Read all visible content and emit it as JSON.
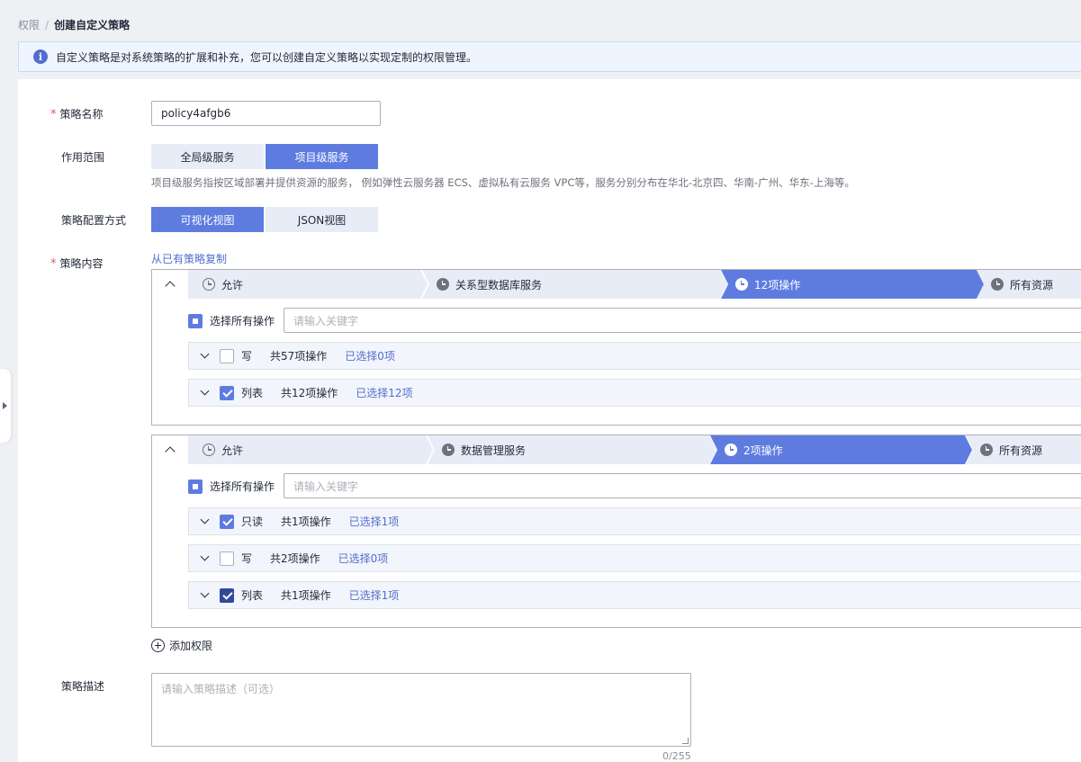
{
  "breadcrumb": {
    "parent": "权限",
    "separator": "/",
    "current": "创建自定义策略"
  },
  "info": {
    "icon": "info-icon",
    "text": "自定义策略是对系统策略的扩展和补充，您可以创建自定义策略以实现定制的权限管理。"
  },
  "form": {
    "policy_name": {
      "label": "策略名称",
      "required": true,
      "value": "policy4afgb6"
    },
    "scope": {
      "label": "作用范围",
      "options": [
        "全局级服务",
        "项目级服务"
      ],
      "selected": "项目级服务",
      "hint": "项目级服务指按区域部署并提供资源的服务， 例如弹性云服务器 ECS、虚拟私有云服务 VPC等，服务分别分布在华北-北京四、华南-广州、华东-上海等。"
    },
    "config_mode": {
      "label": "策略配置方式",
      "options": [
        "可视化视图",
        "JSON视图"
      ],
      "selected": "可视化视图"
    },
    "content": {
      "label": "策略内容",
      "required": true,
      "copy_link": "从已有策略复制",
      "blocks": [
        {
          "steps": [
            "允许",
            "关系型数据库服务",
            "12项操作",
            "所有资源"
          ],
          "active_step": 2,
          "select_all_label": "选择所有操作",
          "search_placeholder": "请输入关键字",
          "groups": [
            {
              "name": "写",
              "count": "共57项操作",
              "selected": "已选择0项",
              "checked": false
            },
            {
              "name": "列表",
              "count": "共12项操作",
              "selected": "已选择12项",
              "checked": true
            }
          ]
        },
        {
          "steps": [
            "允许",
            "数据管理服务",
            "2项操作",
            "所有资源"
          ],
          "active_step": 2,
          "select_all_label": "选择所有操作",
          "search_placeholder": "请输入关键字",
          "groups": [
            {
              "name": "只读",
              "count": "共1项操作",
              "selected": "已选择1项",
              "checked": true
            },
            {
              "name": "写",
              "count": "共2项操作",
              "selected": "已选择0项",
              "checked": false
            },
            {
              "name": "列表",
              "count": "共1项操作",
              "selected": "已选择1项",
              "checked": true
            }
          ]
        }
      ],
      "add_label": "添加权限"
    },
    "description": {
      "label": "策略描述",
      "placeholder": "请输入策略描述（可选）",
      "counter": "0/255"
    }
  },
  "colors": {
    "accent": "#5e7ce0",
    "link": "#526ecc",
    "required": "#e05858"
  }
}
